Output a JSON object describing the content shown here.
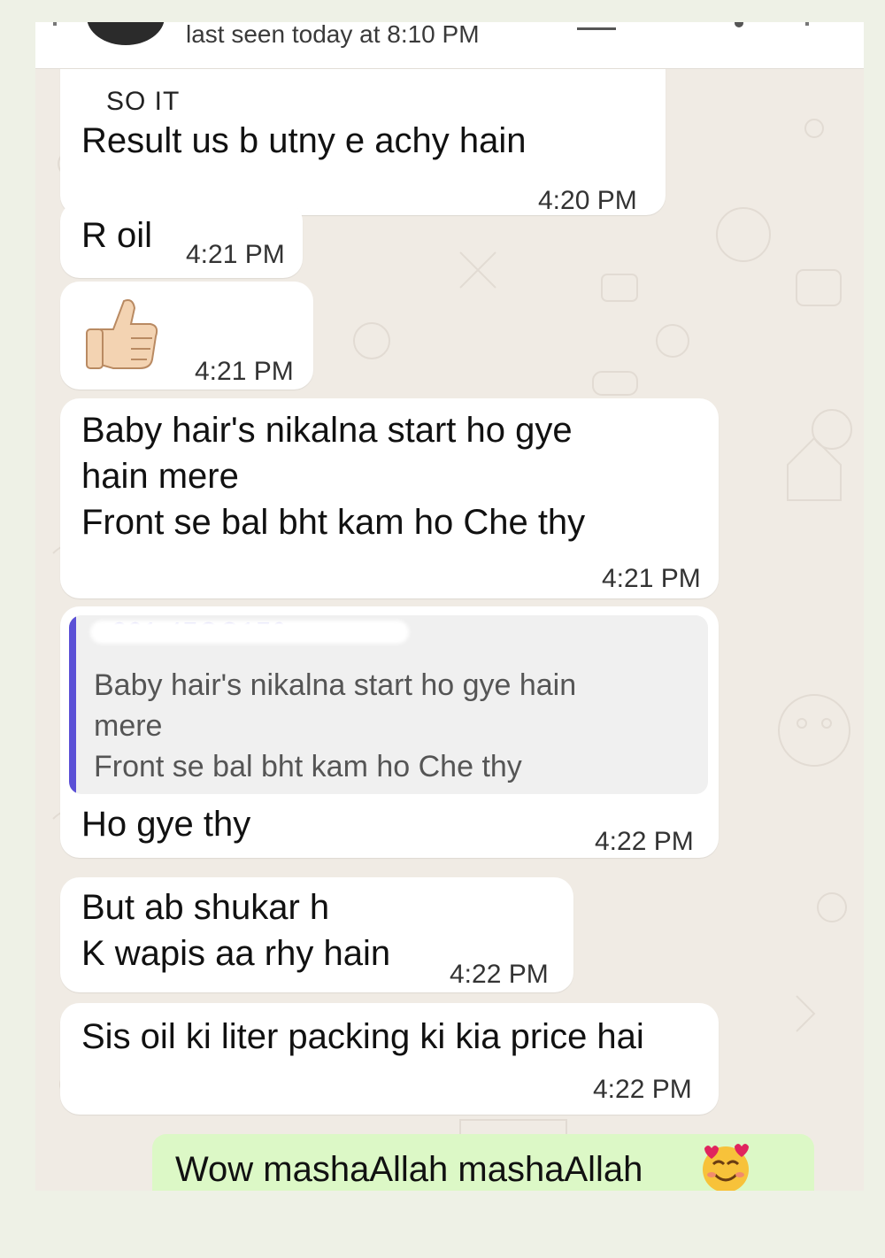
{
  "header": {
    "last_seen": "last seen today at 8:10 PM"
  },
  "messages": [
    {
      "clipped_text": "SO IT",
      "text": "Result us b utny e achy hain",
      "time": "4:20 PM"
    },
    {
      "text": "R oil",
      "time": "4:21 PM"
    },
    {
      "icon": "thumbs-up-emoji",
      "time": "4:21 PM"
    },
    {
      "lines": [
        "Baby hair's nikalna start ho gye",
        "hain mere",
        "Front se bal bht kam ho Che thy"
      ],
      "time": "4:21 PM"
    },
    {
      "reply": {
        "author_partial": "·  321 47OO170",
        "text": "Baby hair's nikalna start ho gye hain\nmere\nFront se bal bht kam ho Che thy"
      },
      "text": "Ho gye thy",
      "time": "4:22 PM"
    },
    {
      "lines": [
        "But ab shukar h",
        "K wapis aa rhy hain"
      ],
      "time": "4:22 PM"
    },
    {
      "text": "Sis oil ki liter packing ki kia price hai",
      "time": "4:22 PM"
    }
  ],
  "outgoing": {
    "text": "Wow mashaAllah mashaAllah",
    "emoji": "smiling-face-with-hearts"
  },
  "colors": {
    "chat_bg": "#f0ebe4",
    "incoming_bubble": "#ffffff",
    "outgoing_bubble": "#dcf8c6",
    "reply_accent": "#5b50d6"
  }
}
